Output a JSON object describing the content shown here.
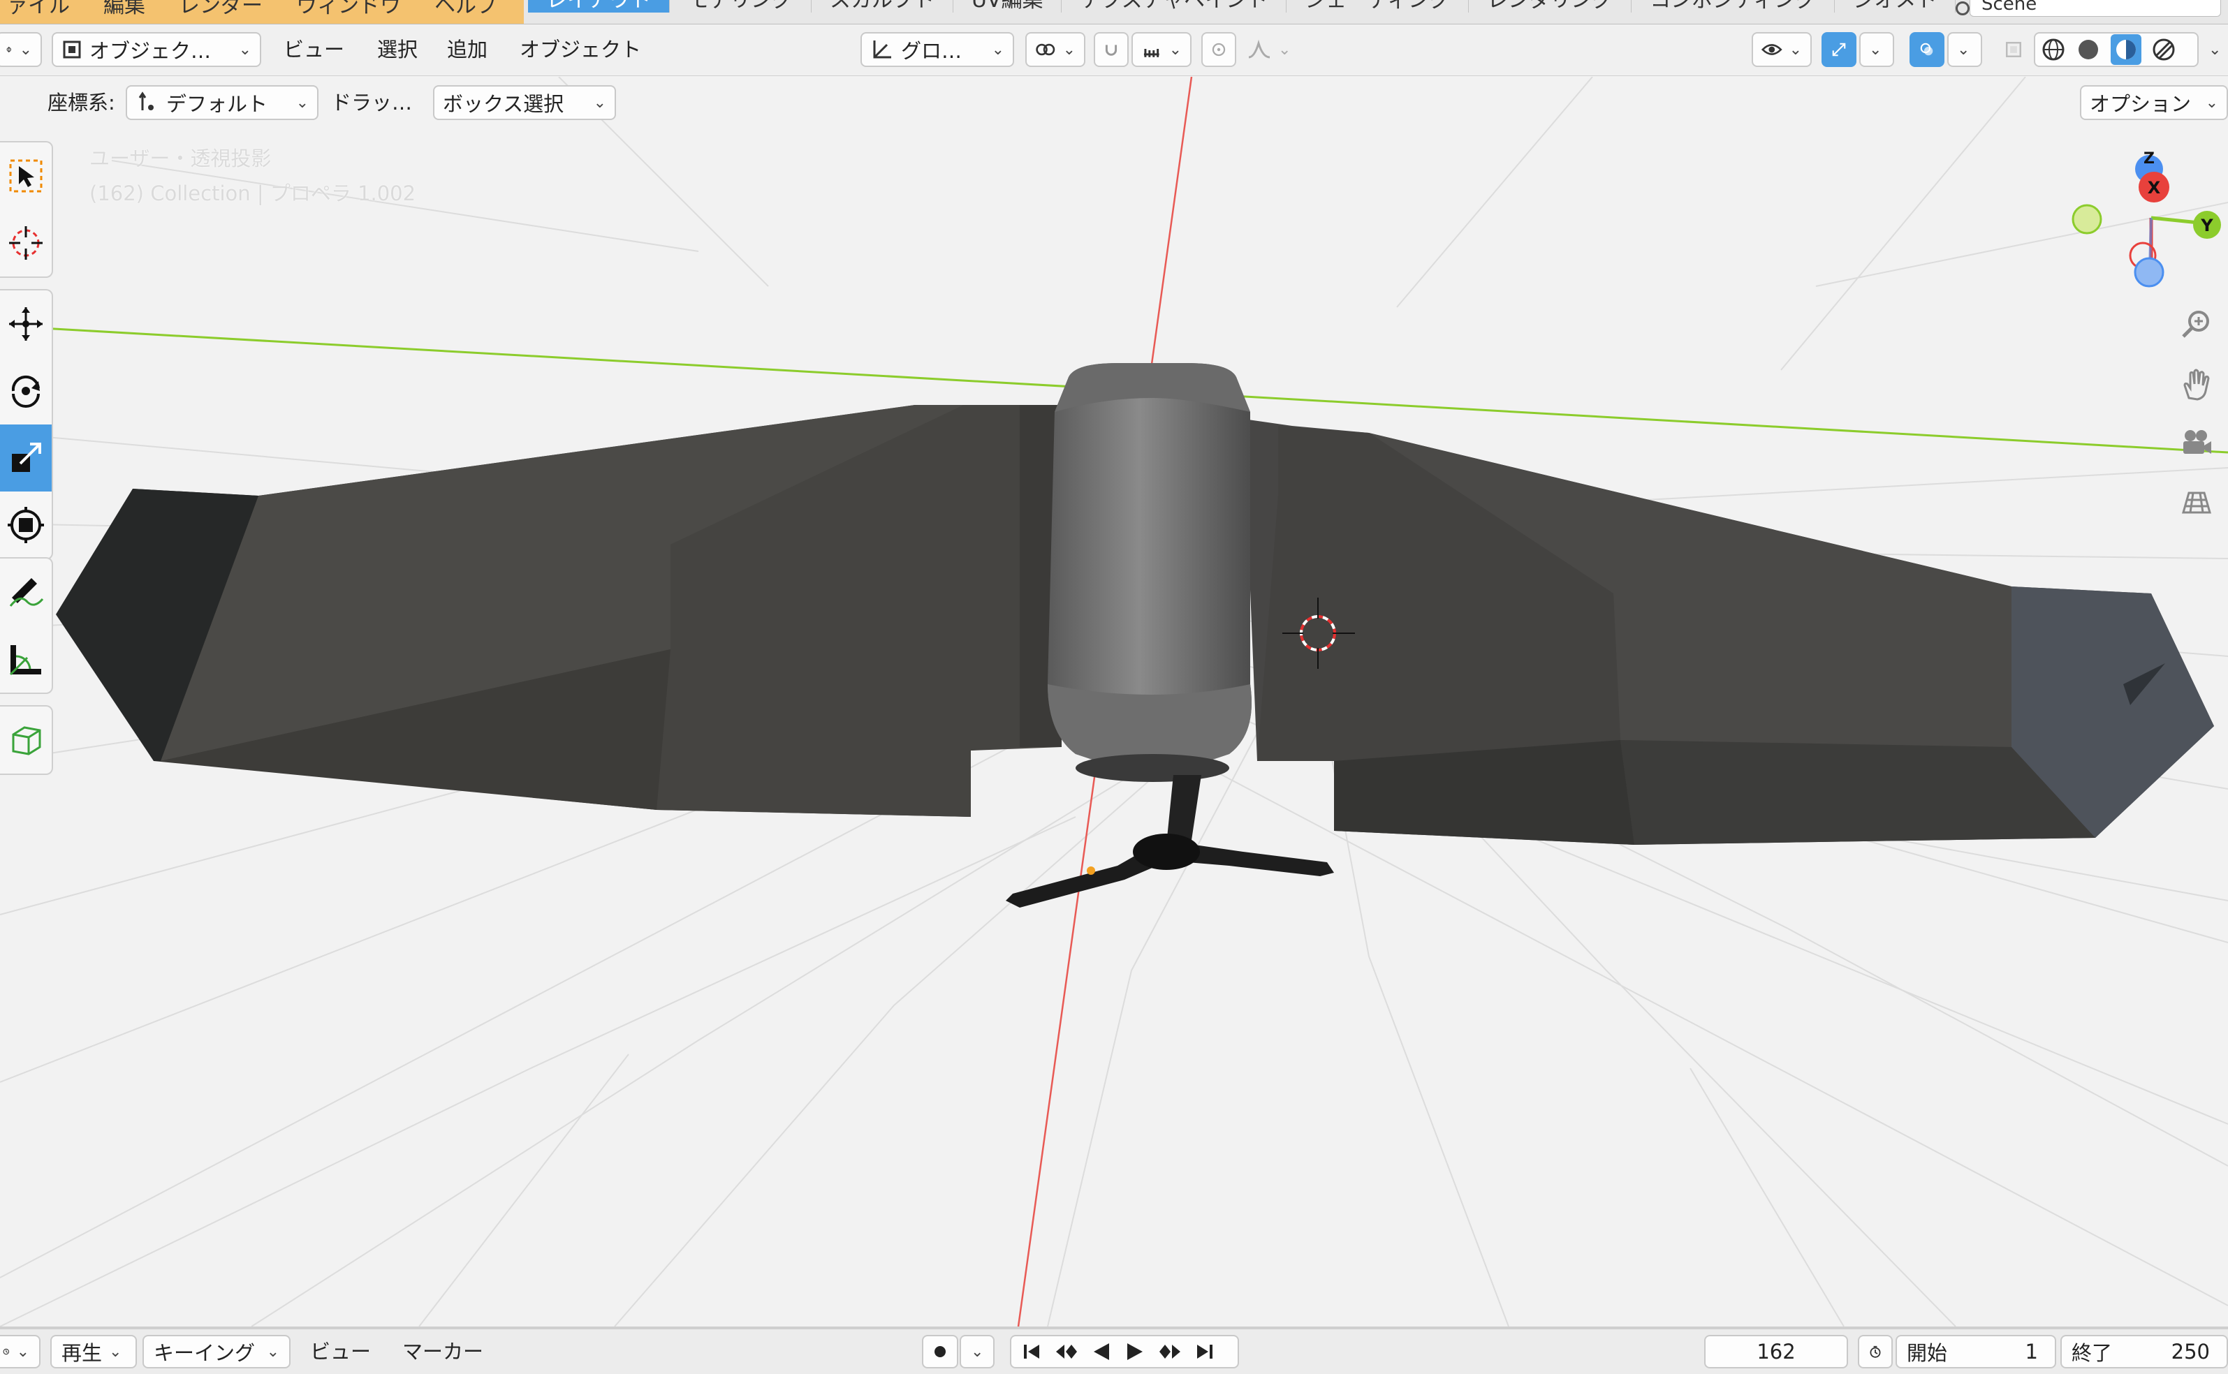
{
  "menubar": {
    "items": [
      "ァイル",
      "編集",
      "レンダー",
      "ウィンドウ",
      "ヘルプ"
    ],
    "workspace_tabs": [
      "レイアウト",
      "モデリング",
      "スカルプト",
      "UV編集",
      "テクスチャペイント",
      "シェーディング",
      "レンダリング",
      "コンポジティング",
      "ジオメト"
    ],
    "active_tab": "レイアウト",
    "scene_name": "Scene"
  },
  "header": {
    "mode": "オブジェク…",
    "menus": [
      "ビュー",
      "選択",
      "追加",
      "オブジェクト"
    ],
    "transform_orientation": "グロ…"
  },
  "toolbar2": {
    "coord_label": "座標系:",
    "coord_value": "デフォルト",
    "drag_label": "ドラッ…",
    "select_mode": "ボックス選択",
    "options": "オプション"
  },
  "viewport": {
    "view_name": "ユーザー・透視投影",
    "object_info": "(162) Collection | プロペラ 1.002",
    "gizmo": {
      "x": "X",
      "y": "Y",
      "z": "Z"
    },
    "colors": {
      "x_axis": "#e8413c",
      "y_axis": "#8ccc2c",
      "z_axis": "#4b8ff0",
      "accent": "#4a9de3"
    }
  },
  "left_tools": [
    "select-box",
    "cursor",
    "move",
    "rotate",
    "scale",
    "transform",
    "annotate",
    "measure",
    "add-cube"
  ],
  "timeline": {
    "play": "再生",
    "keying": "キーイング",
    "view": "ビュー",
    "marker": "マーカー",
    "current_frame": "162",
    "start_label": "開始",
    "start_value": "1",
    "end_label": "終了",
    "end_value": "250"
  }
}
